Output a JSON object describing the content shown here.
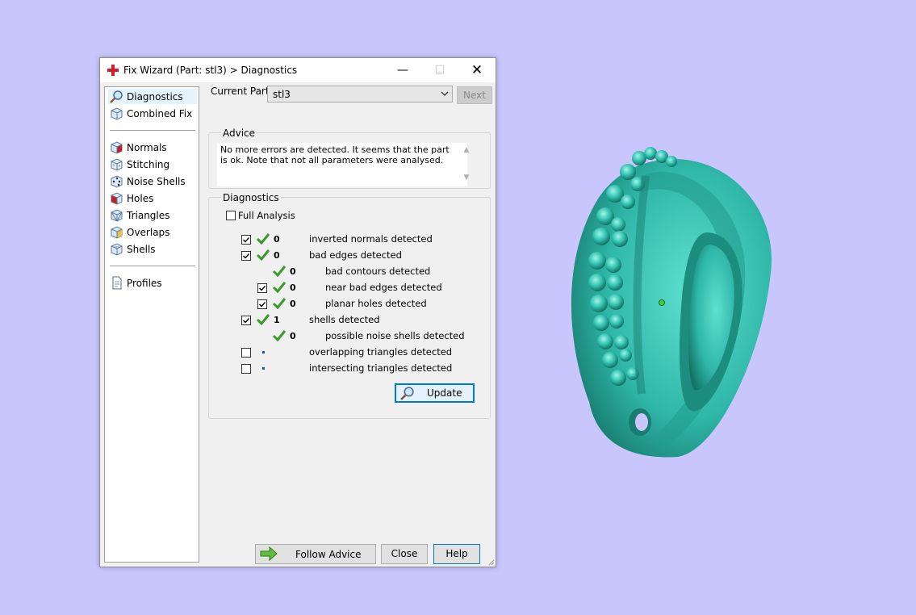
{
  "window": {
    "title": "Fix Wizard (Part: stl3) > Diagnostics",
    "controls": {
      "minimize": "—",
      "maximize": "☐",
      "close": "✕"
    }
  },
  "sidebar": {
    "items": [
      {
        "label": "Diagnostics",
        "icon": "magnifier-icon",
        "selected": true
      },
      {
        "label": "Combined Fix",
        "icon": "cube-icon"
      },
      {
        "label": "Normals",
        "icon": "normals-cube-icon"
      },
      {
        "label": "Stitching",
        "icon": "stitching-cube-icon"
      },
      {
        "label": "Noise Shells",
        "icon": "noise-shells-cube-icon"
      },
      {
        "label": "Holes",
        "icon": "holes-cube-icon"
      },
      {
        "label": "Triangles",
        "icon": "triangles-cube-icon"
      },
      {
        "label": "Overlaps",
        "icon": "overlaps-cube-icon"
      },
      {
        "label": "Shells",
        "icon": "shells-cube-icon"
      },
      {
        "label": "Profiles",
        "icon": "document-icon"
      }
    ]
  },
  "current_part": {
    "label": "Current Part:",
    "value": "stl3",
    "next_label": "Next"
  },
  "advice": {
    "title": "Advice",
    "text": "No more errors are detected. It seems that the part is ok. Note that not all parameters were analysed."
  },
  "diagnostics": {
    "title": "Diagnostics",
    "full_analysis_label": "Full Analysis",
    "full_analysis_checked": false,
    "rows": [
      {
        "checkbox": true,
        "checked": true,
        "status": "ok",
        "count": "0",
        "label": "inverted normals detected",
        "indent": 0
      },
      {
        "checkbox": true,
        "checked": true,
        "status": "ok",
        "count": "0",
        "label": "bad edges detected",
        "indent": 0
      },
      {
        "checkbox": false,
        "checked": false,
        "status": "ok",
        "count": "0",
        "label": "bad contours detected",
        "indent": 1
      },
      {
        "checkbox": true,
        "checked": true,
        "status": "ok",
        "count": "0",
        "label": "near bad edges detected",
        "indent": 1
      },
      {
        "checkbox": true,
        "checked": true,
        "status": "ok",
        "count": "0",
        "label": "planar holes detected",
        "indent": 1
      },
      {
        "checkbox": true,
        "checked": true,
        "status": "ok",
        "count": "1",
        "label": "shells detected",
        "indent": 0
      },
      {
        "checkbox": false,
        "checked": false,
        "status": "ok",
        "count": "0",
        "label": "possible noise shells detected",
        "indent": 1
      },
      {
        "checkbox": true,
        "checked": false,
        "status": "none",
        "count": "",
        "label": "overlapping triangles detected",
        "indent": 0
      },
      {
        "checkbox": true,
        "checked": false,
        "status": "none",
        "count": "",
        "label": "intersecting triangles detected",
        "indent": 0
      }
    ],
    "update_label": "Update"
  },
  "footer": {
    "follow_advice_label": "Follow Advice",
    "close_label": "Close",
    "help_label": "Help"
  },
  "colors": {
    "desktop": "#c8c6fc",
    "model": "#2fb7a8",
    "check_green": "#3a9a2a",
    "selection": "#e5f3ff",
    "default_button_border": "#0078d7"
  }
}
